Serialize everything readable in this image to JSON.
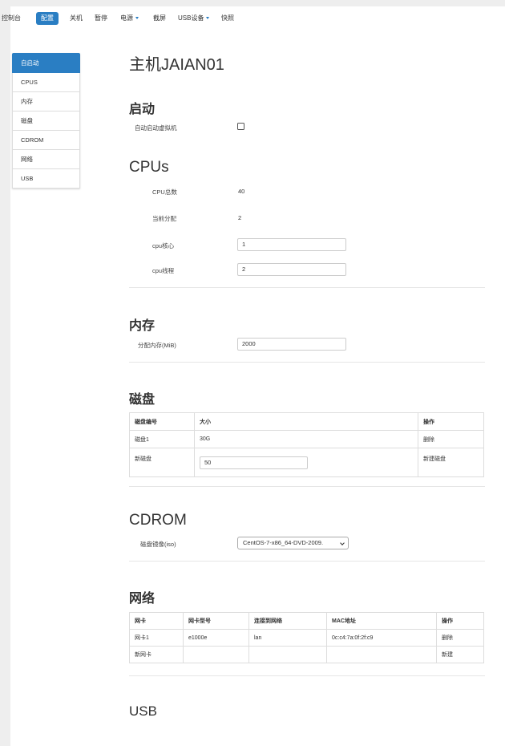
{
  "navbar": {
    "items": [
      {
        "label": "控制台"
      },
      {
        "label": "配置"
      },
      {
        "label": "关机"
      },
      {
        "label": "暂停"
      },
      {
        "label": "电源"
      },
      {
        "label": "截屏"
      },
      {
        "label": "USB设备"
      },
      {
        "label": "快照"
      }
    ]
  },
  "sidebar": {
    "items": [
      {
        "label": "自启动"
      },
      {
        "label": "CPUS"
      },
      {
        "label": "内存"
      },
      {
        "label": "磁盘"
      },
      {
        "label": "CDROM"
      },
      {
        "label": "网络"
      },
      {
        "label": "USB"
      }
    ]
  },
  "page_title": "主机JAIAN01",
  "autostart": {
    "heading": "启动",
    "label": "自动启动虚拟机",
    "checked": false
  },
  "cpus": {
    "heading": "CPUs",
    "total_label": "CPU总数",
    "total_value": "40",
    "alloc_label": "当前分配",
    "alloc_value": "2",
    "cores_label": "cpu核心",
    "cores_value": "1",
    "threads_label": "cpu线程",
    "threads_value": "2"
  },
  "memory": {
    "heading": "内存",
    "label": "分配内存(MiB)",
    "value": "2000"
  },
  "disk": {
    "heading": "磁盘",
    "headers": [
      "磁盘编号",
      "大小",
      "操作"
    ],
    "rows": [
      {
        "id": "磁盘1",
        "size": "30G",
        "action": "删除"
      }
    ],
    "new_label": "新磁盘",
    "new_value": "50",
    "new_action": "新建磁盘"
  },
  "cdrom": {
    "heading": "CDROM",
    "label": "磁盘镜像(iso)",
    "selected": "CentOS-7-x86_64-DVD-2009."
  },
  "network": {
    "heading": "网络",
    "headers": [
      "网卡",
      "网卡型号",
      "连接到网络",
      "MAC地址",
      "操作"
    ],
    "rows": [
      {
        "nic": "网卡1",
        "model": "e1000e",
        "net": "lan",
        "mac": "0c:c4:7a:0f:2f:c9",
        "action": "删除"
      }
    ],
    "new_label": "新网卡",
    "new_action": "新建"
  },
  "usb": {
    "heading": "USB"
  },
  "colors": {
    "accent": "#2a7ec3"
  }
}
